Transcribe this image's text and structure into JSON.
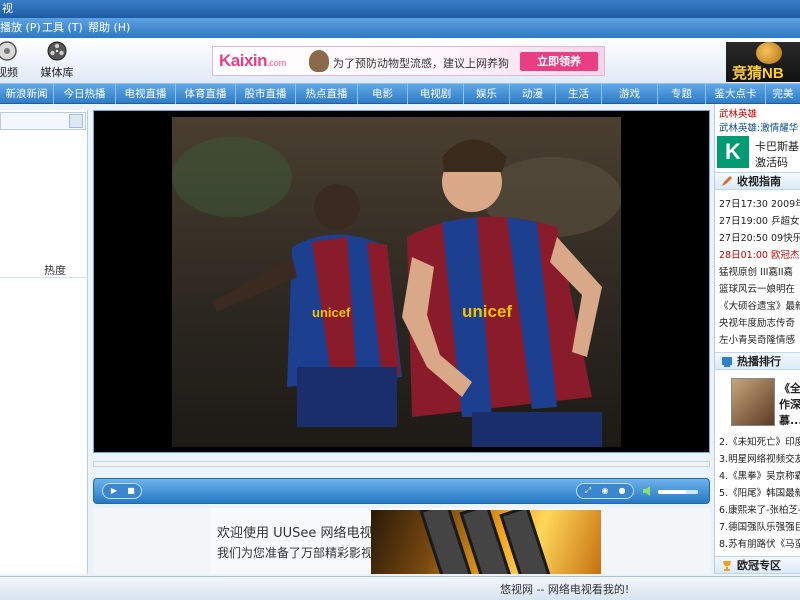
{
  "window": {
    "title": "视"
  },
  "menu": [
    "播放 (P)",
    "工具 (T)",
    "帮助 (H)"
  ],
  "toolbar": {
    "buttons": [
      {
        "label": "视频",
        "icon": "film-icon"
      },
      {
        "label": "媒体库",
        "icon": "film-reel-icon"
      }
    ]
  },
  "banner_ad": {
    "logo": "Kaixin",
    "logo_suffix": ".com",
    "logo_badge": "开心网",
    "slogan": "为了预防动物型流感，建议上网养狗",
    "cta": "立即领养"
  },
  "side_ad": {
    "text": "竞猜NB"
  },
  "nav": [
    "新浪新闻",
    "今日热播",
    "电视直播",
    "体育直播",
    "股市直播",
    "热点直播",
    "电影",
    "电视剧",
    "娱乐",
    "动漫",
    "生活",
    "游戏",
    "专题",
    "鉴大点卡",
    "完美"
  ],
  "left_panel": {
    "column_header": "热度"
  },
  "player": {
    "controls": [
      "play",
      "stop",
      "fullscreen",
      "minimize",
      "record",
      "volume"
    ],
    "volume_level": 0.7
  },
  "bottom_ad": {
    "line1": "欢迎使用 UUSee 网络电视",
    "line2": "我们为您准备了万部精彩影视"
  },
  "right_panel": {
    "top_items": [
      "武林英雄",
      "武林英雄:激情耀华"
    ],
    "kaspersky": {
      "line1": "卡巴斯基",
      "line2": "激活码"
    },
    "guide_title": "收视指南",
    "guide_items": [
      "27日17:30 2009年",
      "27日19:00 乒超女",
      "27日20:50 09快乐",
      "28日01:00 欧冠杰",
      "猛视原创 III嘉II嘉",
      "篮球风云一娘明在",
      "《大硕谷遗宝》最新",
      "央视年度励志传奇",
      "左小青吴奇隆情感"
    ],
    "hot_title": "热播排行",
    "hot_featured": [
      "《全",
      "作深",
      "慕..."
    ],
    "hot_items": [
      "2.《未知死亡》印度最",
      "3.明星网络视频交友",
      "4.《黑拳》吴京称霸拳",
      "5.《阳尾》韩国最新动",
      "6.康熙来了-张柏芝-",
      "7.德国强队乐强强巨",
      "8.苏有朋路伏《马蛮》"
    ],
    "bottom_title": "欧冠专区"
  },
  "status": {
    "text": "悠视网 -- 网络电视看我的!"
  }
}
